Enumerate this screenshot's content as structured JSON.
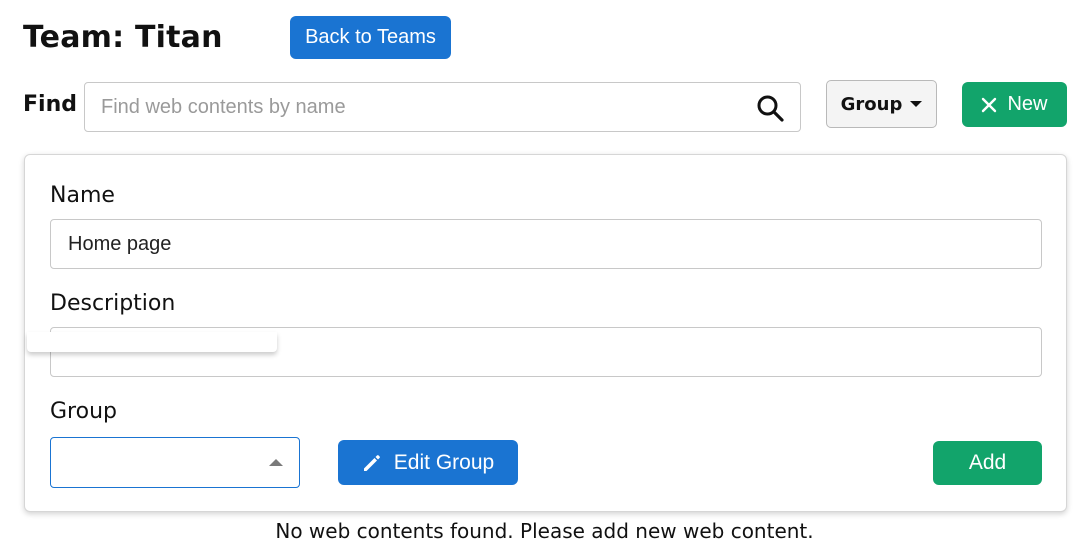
{
  "header": {
    "title": "Team: Titan",
    "back_label": "Back to Teams"
  },
  "toolbar": {
    "find_label": "Find",
    "search_placeholder": "Find web contents by name",
    "search_value": "",
    "group_label": "Group",
    "new_label": "New"
  },
  "form": {
    "name_label": "Name",
    "name_value": "Home page",
    "description_label": "Description",
    "description_value": "",
    "group_label": "Group",
    "group_value": "",
    "edit_group_label": "Edit Group",
    "add_label": "Add"
  },
  "empty_message": "No web contents found. Please add new web content.",
  "colors": {
    "primary": "#1a74d2",
    "success": "#12a46b"
  },
  "icons": {
    "search": "search-icon",
    "close": "close-icon",
    "pencil": "pencil-icon",
    "caret_down": "caret-down-icon",
    "caret_up": "caret-up-icon"
  }
}
